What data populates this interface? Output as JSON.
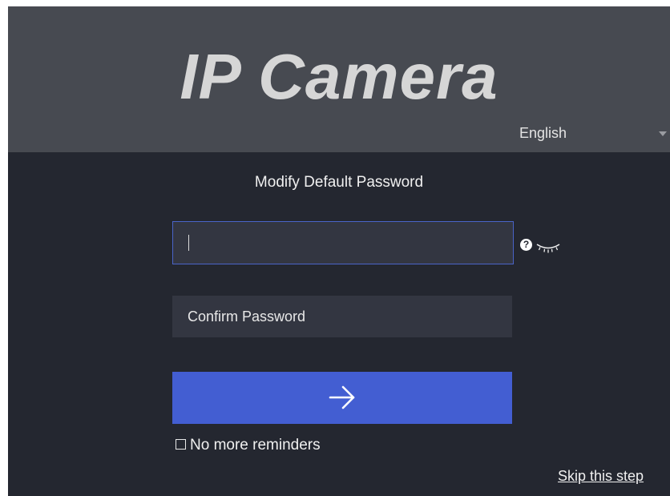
{
  "header": {
    "app_title": "IP Camera",
    "language": {
      "selected": "English",
      "arrow_icon": "caret-down-icon"
    }
  },
  "dialog": {
    "title": "Modify Default Password",
    "password_field": {
      "value": "",
      "placeholder": ""
    },
    "help_icon": {
      "icon": "question-circle-icon",
      "glyph": "?"
    },
    "visibility_icon": {
      "icon": "eye-closed-icon"
    },
    "confirm_field": {
      "value": "",
      "placeholder": "Confirm Password"
    },
    "submit": {
      "icon": "arrow-right-icon"
    },
    "no_more_reminders": {
      "label": "No more reminders",
      "checked": false
    },
    "skip_link": "Skip this step"
  },
  "colors": {
    "header_bg": "#474a51",
    "body_bg": "#242730",
    "input_bg": "#333641",
    "focus_border": "#4a64c8",
    "accent": "#435ed2",
    "title_text": "#d6d6d6"
  }
}
